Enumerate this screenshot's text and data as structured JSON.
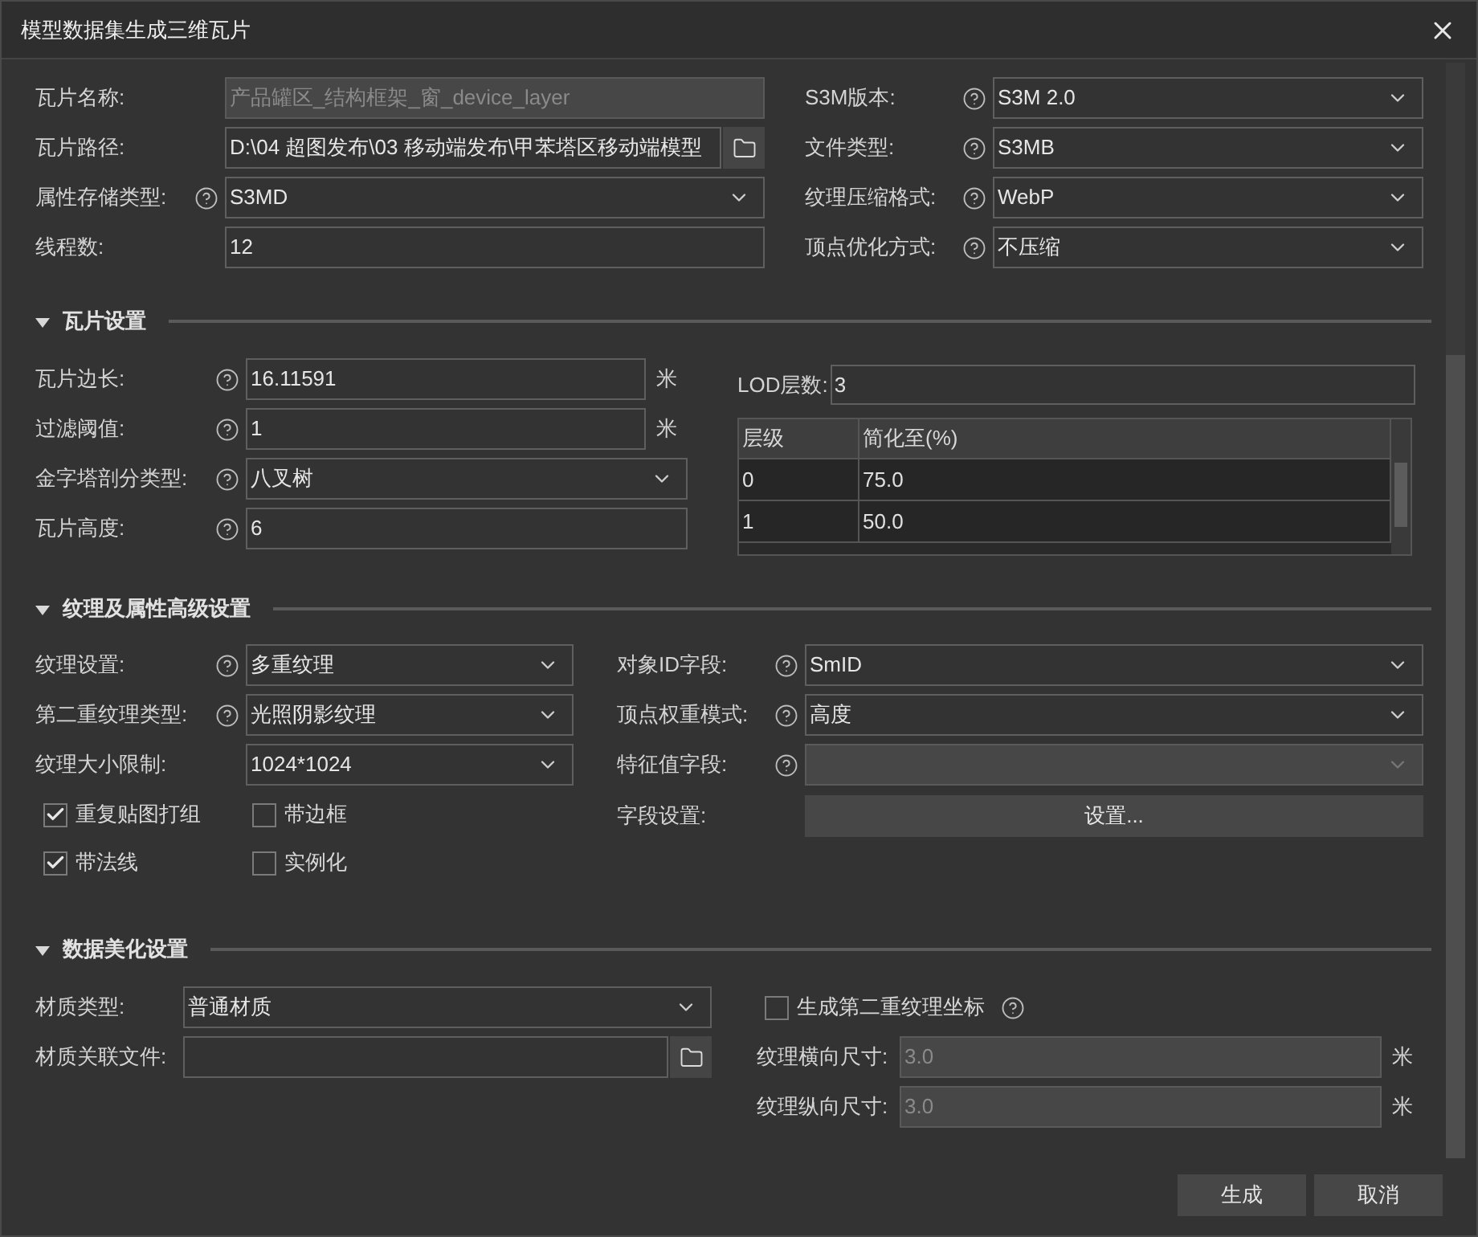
{
  "window": {
    "title": "模型数据集生成三维瓦片"
  },
  "general": {
    "left": [
      {
        "kind": "text",
        "label": "瓦片名称:",
        "help": false,
        "value": "产品罐区_结构框架_窗_device_layer",
        "disabled": true
      },
      {
        "kind": "path",
        "label": "瓦片路径:",
        "help": false,
        "value": "D:\\04 超图发布\\03 移动端发布\\甲苯塔区移动端模型",
        "disabled": false
      },
      {
        "kind": "select",
        "label": "属性存储类型:",
        "help": true,
        "value": "S3MD",
        "disabled": false
      },
      {
        "kind": "text",
        "label": "线程数:",
        "help": false,
        "value": "12",
        "disabled": false
      }
    ],
    "right": [
      {
        "kind": "select",
        "label": "S3M版本:",
        "help": true,
        "value": "S3M 2.0",
        "disabled": false
      },
      {
        "kind": "select",
        "label": "文件类型:",
        "help": true,
        "value": "S3MB",
        "disabled": false
      },
      {
        "kind": "select",
        "label": "纹理压缩格式:",
        "help": true,
        "value": "WebP",
        "disabled": false
      },
      {
        "kind": "select",
        "label": "顶点优化方式:",
        "help": true,
        "value": "不压缩",
        "disabled": false
      }
    ]
  },
  "tile_section": {
    "title": "瓦片设置",
    "expanded": true,
    "left": [
      {
        "kind": "text",
        "label": "瓦片边长:",
        "help": true,
        "value": "16.11591",
        "disabled": false,
        "unit": "米"
      },
      {
        "kind": "text",
        "label": "过滤阈值:",
        "help": true,
        "value": "1",
        "disabled": false,
        "unit": "米"
      },
      {
        "kind": "select",
        "label": "金字塔剖分类型:",
        "help": true,
        "value": "八叉树",
        "disabled": false
      },
      {
        "kind": "text",
        "label": "瓦片高度:",
        "help": true,
        "value": "6",
        "disabled": false
      }
    ],
    "lod": {
      "label": "LOD层数:",
      "value": "3"
    },
    "table": {
      "columns": [
        "层级",
        "简化至(%)"
      ],
      "rows": [
        [
          "0",
          "75.0"
        ],
        [
          "1",
          "50.0"
        ]
      ]
    }
  },
  "texture_section": {
    "title": "纹理及属性高级设置",
    "expanded": true,
    "left": [
      {
        "kind": "select",
        "label": "纹理设置:",
        "help": true,
        "value": "多重纹理",
        "disabled": false
      },
      {
        "kind": "select",
        "label": "第二重纹理类型:",
        "help": true,
        "value": "光照阴影纹理",
        "disabled": false
      },
      {
        "kind": "select",
        "label": "纹理大小限制:",
        "help": false,
        "value": "1024*1024",
        "disabled": false
      }
    ],
    "checks": [
      {
        "label": "重复贴图打组",
        "checked": true
      },
      {
        "label": "带边框",
        "checked": false
      },
      {
        "label": "带法线",
        "checked": true
      },
      {
        "label": "实例化",
        "checked": false
      }
    ],
    "right": [
      {
        "kind": "select",
        "label": "对象ID字段:",
        "help": true,
        "value": "SmID",
        "disabled": false
      },
      {
        "kind": "select",
        "label": "顶点权重模式:",
        "help": true,
        "value": "高度",
        "disabled": false
      },
      {
        "kind": "select",
        "label": "特征值字段:",
        "help": true,
        "disabled": true
      }
    ],
    "field_settings": {
      "label": "字段设置:",
      "button": "设置..."
    }
  },
  "beautify_section": {
    "title": "数据美化设置",
    "expanded": true,
    "left": [
      {
        "kind": "select",
        "label": "材质类型:",
        "help": false,
        "value": "普通材质",
        "disabled": false
      },
      {
        "kind": "path",
        "label": "材质关联文件:",
        "help": false,
        "disabled": false
      }
    ],
    "second_uv": {
      "label": "生成第二重纹理坐标",
      "checked": false,
      "help": true
    },
    "right": [
      {
        "kind": "text",
        "label": "纹理横向尺寸:",
        "help": false,
        "value": "3.0",
        "disabled": true,
        "unit": "米"
      },
      {
        "kind": "text",
        "label": "纹理纵向尺寸:",
        "help": false,
        "value": "3.0",
        "disabled": true,
        "unit": "米"
      }
    ]
  },
  "buttons": [
    "生成",
    "取消"
  ]
}
